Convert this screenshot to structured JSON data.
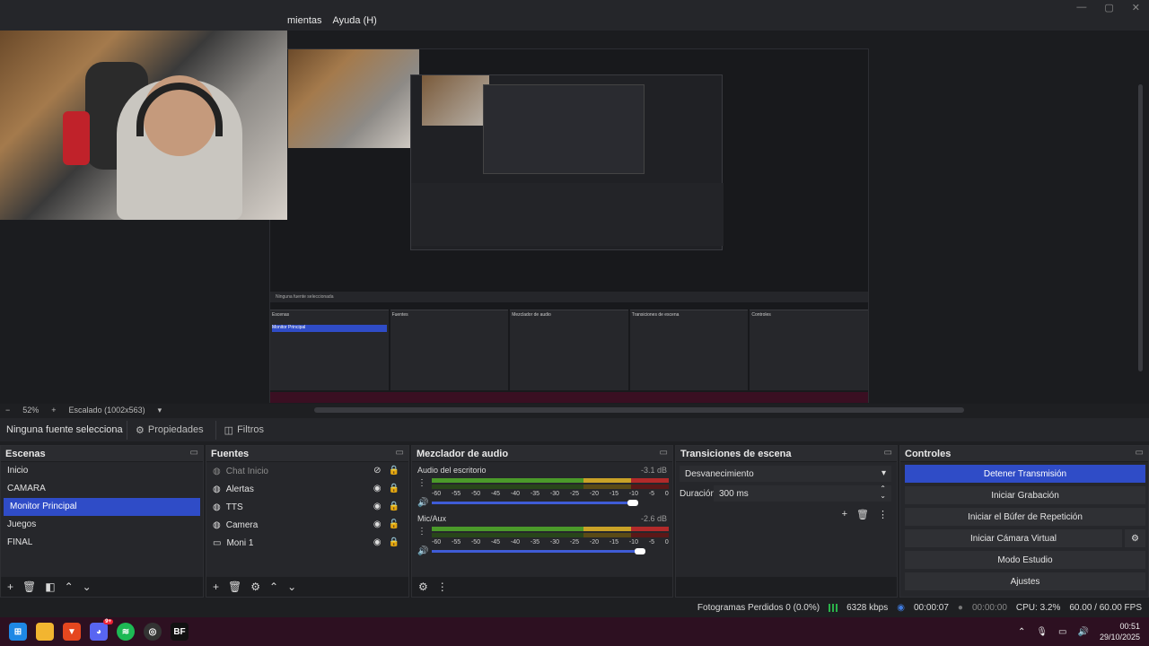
{
  "menu": {
    "items": [
      "mientas",
      "Ayuda (H)"
    ],
    "window_controls": [
      "—",
      "▢",
      "✕"
    ]
  },
  "preview": {
    "nested_menu": [
      "mientas",
      "Ayuda (H)"
    ],
    "nested_source_bar": "Ninguna fuente seleccionada",
    "nested_panels": [
      "Escenas",
      "Fuentes",
      "Mezclador de audio",
      "Transiciones de escena",
      "Controles"
    ],
    "nested_active_scene": "Monitor Principal",
    "nested_status": "Fotogramas Perdidos 0 (0.0%)"
  },
  "zoombar": {
    "minus": "−",
    "zoom": "52%",
    "plus": "+",
    "scale": "Escalado (1002x563)"
  },
  "source_toolbar": {
    "selected": "Ninguna fuente seleccionar",
    "properties": "Propiedades",
    "filters": "Filtros"
  },
  "scenes": {
    "title": "Escenas",
    "items": [
      {
        "label": "Inicio",
        "active": false
      },
      {
        "label": "CAMARA",
        "active": false
      },
      {
        "label": "Monitor Principal",
        "active": true
      },
      {
        "label": "Juegos",
        "active": false
      },
      {
        "label": "FINAL",
        "active": false
      }
    ]
  },
  "sources": {
    "title": "Fuentes",
    "items": [
      {
        "label": "Chat Inicio",
        "icon": "browser-icon",
        "visible": false
      },
      {
        "label": "Alertas",
        "icon": "browser-icon",
        "visible": true
      },
      {
        "label": "TTS",
        "icon": "browser-icon",
        "visible": true
      },
      {
        "label": "Camera",
        "icon": "browser-icon",
        "visible": true
      },
      {
        "label": "Moni 1",
        "icon": "monitor-icon",
        "visible": true
      }
    ]
  },
  "mixer": {
    "title": "Mezclador de audio",
    "ticks": [
      "-60",
      "-55",
      "-50",
      "-45",
      "-40",
      "-35",
      "-30",
      "-25",
      "-20",
      "-15",
      "-10",
      "-5",
      "0"
    ],
    "channels": [
      {
        "name": "Audio del escritorio",
        "db": "-3.1 dB",
        "volume": 0.85
      },
      {
        "name": "Mic/Aux",
        "db": "-2.6 dB",
        "volume": 0.88
      }
    ]
  },
  "transitions": {
    "title": "Transiciones de escena",
    "selected": "Desvanecimiento",
    "duration_label": "Duración",
    "duration_value": "300 ms"
  },
  "controls": {
    "title": "Controles",
    "buttons": [
      "Detener Transmisión",
      "Iniciar Grabación",
      "Iniciar el Búfer de Repetición",
      "Iniciar Cámara Virtual",
      "Modo Estudio",
      "Ajustes"
    ]
  },
  "status": {
    "dropped": "Fotogramas Perdidos 0 (0.0%)",
    "bitrate": "6328 kbps",
    "stream_time": "00:00:07",
    "rec_time": "00:00:00",
    "cpu": "CPU: 3.2%",
    "fps": "60.00 / 60.00 FPS"
  },
  "taskbar": {
    "apps": [
      "windows-icon",
      "folder-icon",
      "brave-icon",
      "discord-icon",
      "spotify-icon",
      "obs-icon",
      "bf-icon"
    ],
    "discord_badge": "9+",
    "bf_label": "BF",
    "time": "00:51",
    "date": "29/10/2025"
  },
  "colors": {
    "accent": "#2f4cc7",
    "taskbar": "#2d1021",
    "meter_green": "#4b9a2a",
    "meter_yellow": "#c9a227",
    "meter_red": "#b22a2a"
  }
}
